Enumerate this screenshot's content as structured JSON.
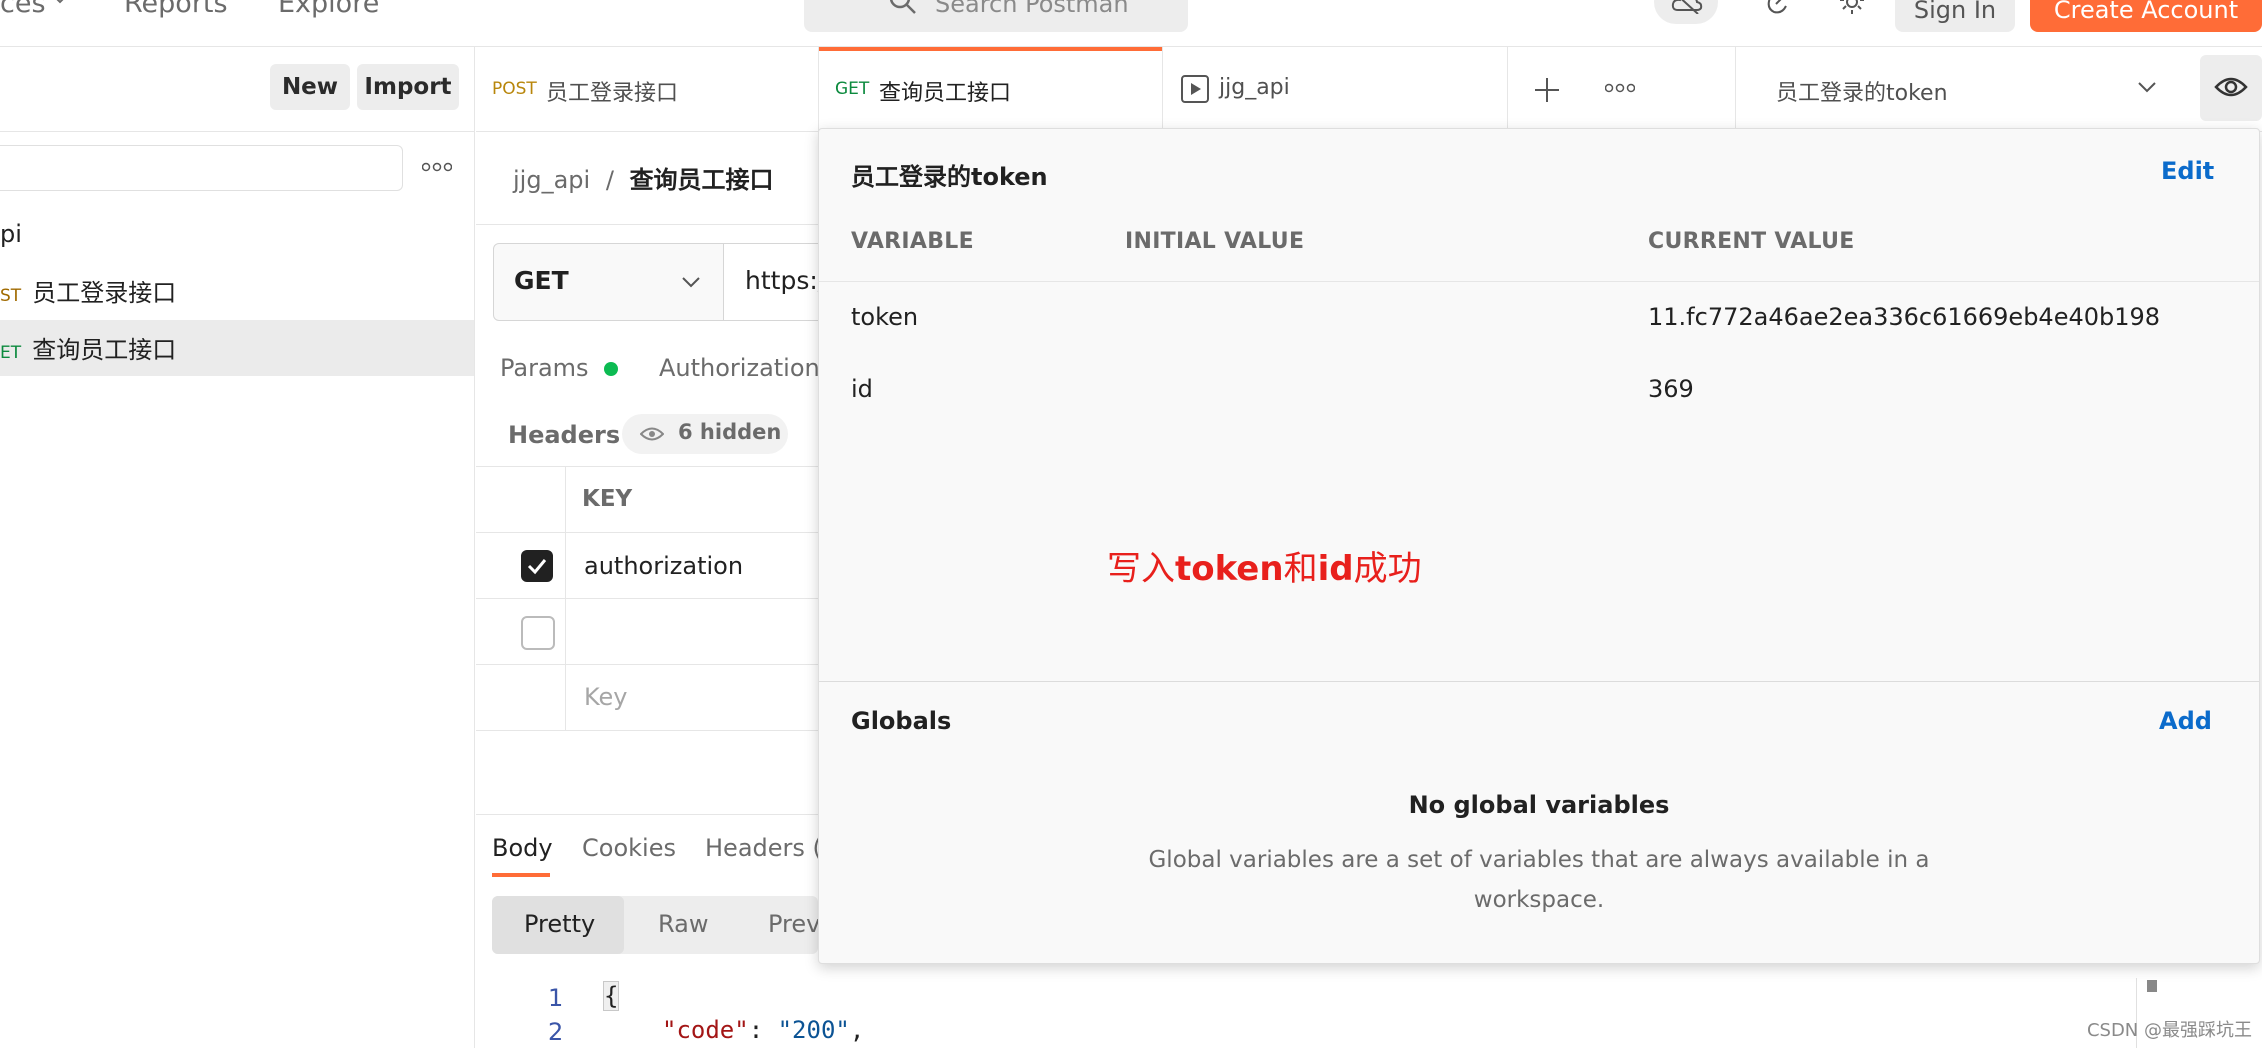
{
  "nav": {
    "left_partial": "ces",
    "reports": "Reports",
    "explore": "Explore",
    "search_placeholder": "Search Postman",
    "sign_in": "Sign In",
    "create_account": "Create Account"
  },
  "sidebar": {
    "new_label": "New",
    "import_label": "Import",
    "collection_partial": "pi",
    "items": [
      {
        "method": "ST",
        "method_color": "#a06a00",
        "label": "员工登录接口"
      },
      {
        "method": "ET",
        "method_color": "#0c8a3e",
        "label": "查询员工接口"
      }
    ]
  },
  "tabs": [
    {
      "method": "POST",
      "method_color": "#b8860b",
      "label": "员工登录接口"
    },
    {
      "method": "GET",
      "method_color": "#0c8a3e",
      "label": "查询员工接口"
    },
    {
      "method": "",
      "label": "jjg_api"
    }
  ],
  "environment": {
    "selected": "员工登录的token"
  },
  "request": {
    "breadcrumb_collection": "jjg_api",
    "breadcrumb_sep": "/",
    "breadcrumb_name": "查询员工接口",
    "method": "GET",
    "url_partial": "https:/",
    "params_tab": "Params",
    "authorization_tab": "Authorization",
    "headers_label": "Headers",
    "hidden_label": "6 hidden",
    "key_header": "KEY",
    "header_rows": [
      {
        "key": "authorization",
        "checked": true
      },
      {
        "key": "",
        "checked": false
      }
    ],
    "key_placeholder": "Key"
  },
  "response": {
    "tabs": [
      "Body",
      "Cookies",
      "Headers ("
    ],
    "views": [
      "Pretty",
      "Raw",
      "Prev"
    ],
    "lines": [
      {
        "num": "1",
        "text": "{"
      },
      {
        "num": "2",
        "key": "\"code\"",
        "colon": ": ",
        "value": "\"200\"",
        "comma": ","
      }
    ]
  },
  "env_popover": {
    "title": "员工登录的token",
    "edit": "Edit",
    "col_variable": "VARIABLE",
    "col_initial": "INITIAL VALUE",
    "col_current": "CURRENT VALUE",
    "rows": [
      {
        "variable": "token",
        "initial": "",
        "current": "11.fc772a46ae2ea336c61669eb4e40b198"
      },
      {
        "variable": "id",
        "initial": "",
        "current": "369"
      }
    ],
    "annotation_a": "写入",
    "annotation_b": "token",
    "annotation_c": "和",
    "annotation_d": "id",
    "annotation_e": "成功",
    "globals_title": "Globals",
    "globals_add": "Add",
    "no_globals": "No global variables",
    "globals_desc_1": "Global variables are a set of variables that are always available in a",
    "globals_desc_2": "workspace."
  },
  "watermark": "CSDN @最强踩坑王"
}
